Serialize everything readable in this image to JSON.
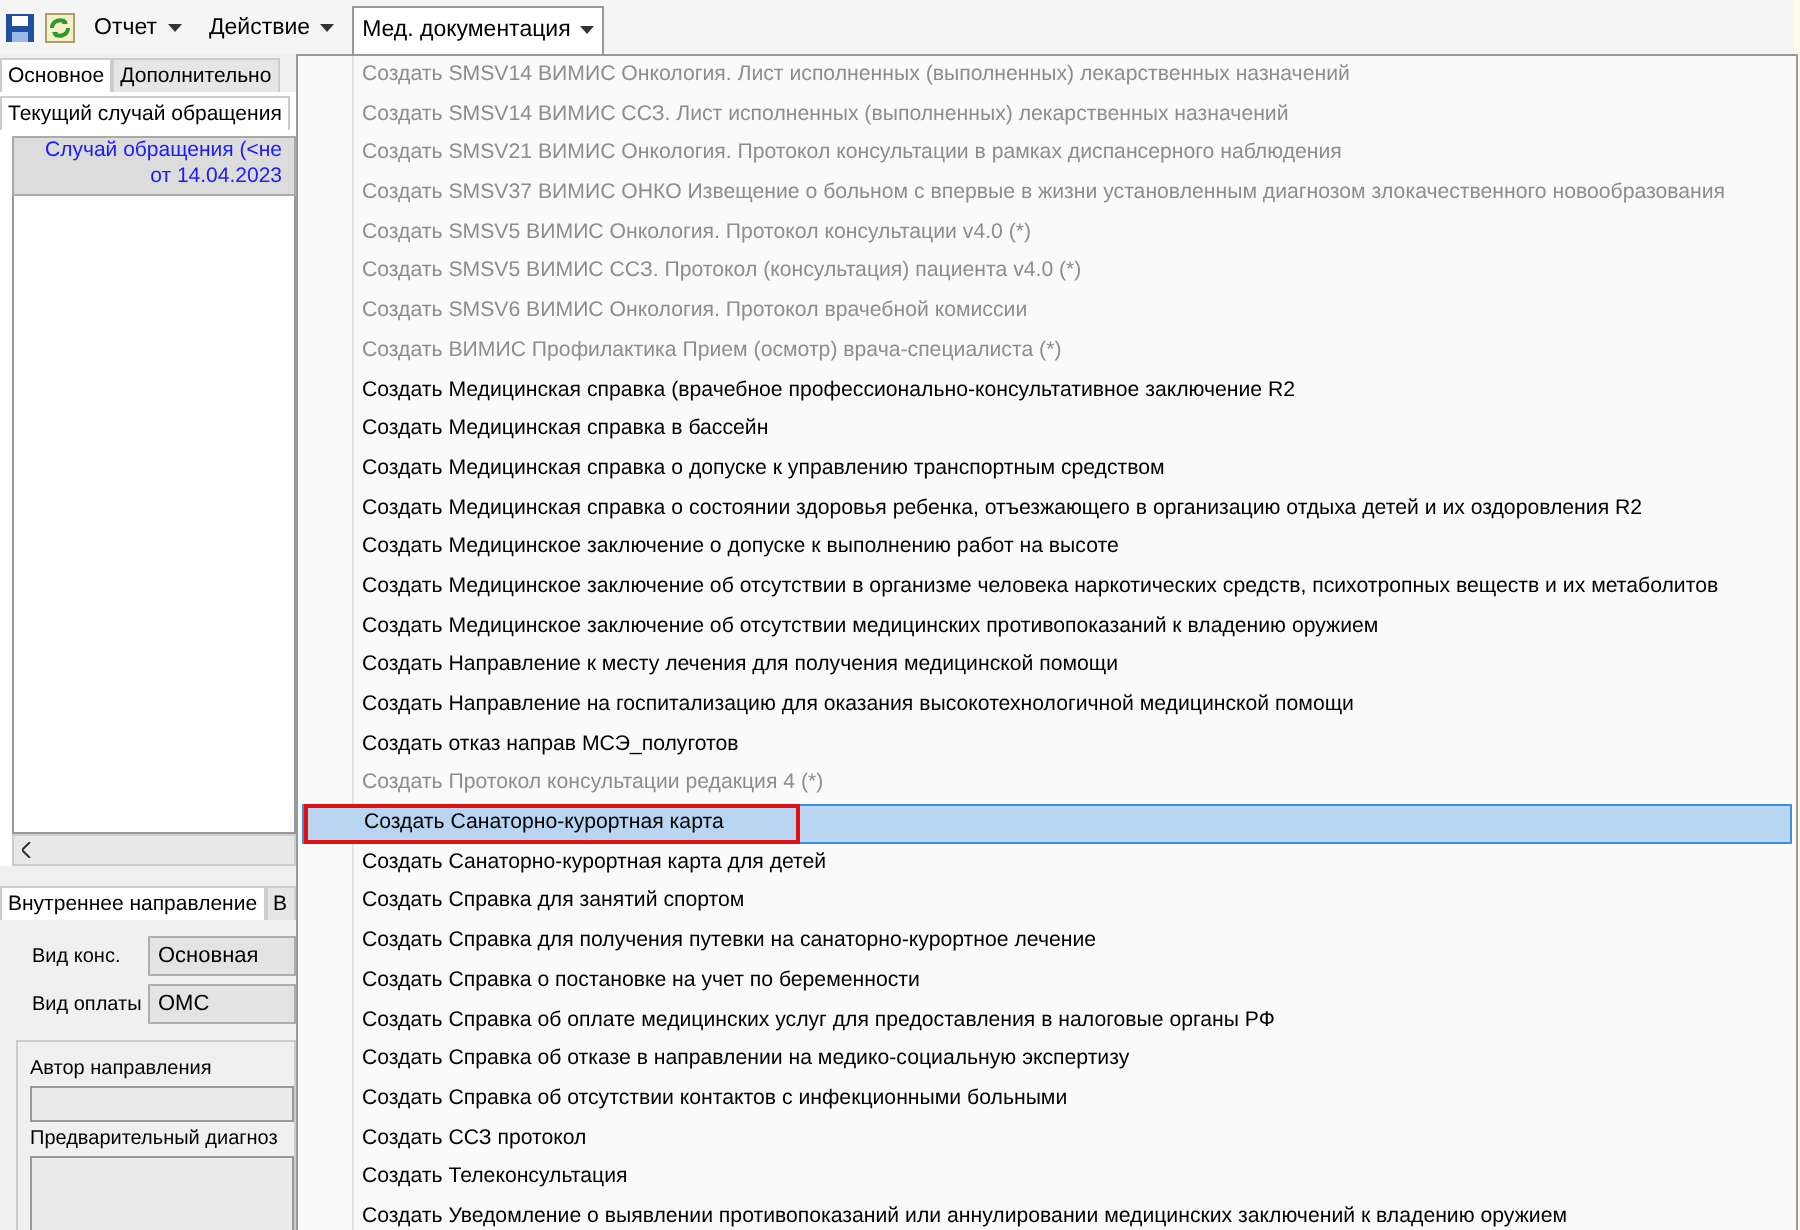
{
  "toolbar": {
    "menus": [
      {
        "label": "Отчет",
        "open": false
      },
      {
        "label": "Действие",
        "open": false
      },
      {
        "label": "Мед. документация",
        "open": true
      }
    ]
  },
  "left_panel": {
    "tabs": [
      {
        "label": "Основное",
        "selected": true
      },
      {
        "label": "Дополнительно",
        "selected": false
      }
    ],
    "subtabs": [
      {
        "label": "Текущий случай обращения",
        "selected": true
      }
    ],
    "case_header": [
      "Случай обращения (<не",
      "от 14.04.2023"
    ],
    "bottom_tabs": [
      {
        "label": "Внутреннее направление",
        "selected": true
      },
      {
        "label": "В",
        "selected": false
      }
    ],
    "fields": [
      {
        "label": "Вид конс.",
        "value": "Основная"
      },
      {
        "label": "Вид оплаты",
        "value": "ОМС"
      }
    ],
    "author_label": "Автор направления",
    "diagnosis_label": "Предварительный диагноз"
  },
  "menu": {
    "items": [
      {
        "label": "Создать SMSV14 ВИМИС  Онкология. Лист исполненных (выполненных) лекарственных назначений",
        "disabled": true,
        "selected": false
      },
      {
        "label": "Создать SMSV14 ВИМИС ССЗ. Лист исполненных (выполненных) лекарственных назначений",
        "disabled": true,
        "selected": false
      },
      {
        "label": "Создать SMSV21 ВИМИС Онкология. Протокол консультации в рамках диспансерного наблюдения",
        "disabled": true,
        "selected": false
      },
      {
        "label": "Создать SMSV37 ВИМИС ОНКО Извещение о больном с впервые в жизни установленным диагнозом злокачественного новообразования",
        "disabled": true,
        "selected": false
      },
      {
        "label": "Создать SMSV5 ВИМИС Онкология. Протокол консультации v4.0 (*)",
        "disabled": true,
        "selected": false
      },
      {
        "label": "Создать SMSV5 ВИМИС ССЗ. Протокол (консультация) пациента v4.0 (*)",
        "disabled": true,
        "selected": false
      },
      {
        "label": "Создать SMSV6 ВИМИС Онкология. Протокол врачебной комиссии",
        "disabled": true,
        "selected": false
      },
      {
        "label": "Создать ВИМИС Профилактика Прием (осмотр) врача-специалиста (*)",
        "disabled": true,
        "selected": false
      },
      {
        "label": "Создать Медицинская справка (врачебное профессионально-консультативное заключение R2",
        "disabled": false,
        "selected": false
      },
      {
        "label": "Создать Медицинская справка в бассейн",
        "disabled": false,
        "selected": false
      },
      {
        "label": "Создать Медицинская справка о допуске к управлению транспортным средством",
        "disabled": false,
        "selected": false
      },
      {
        "label": "Создать Медицинская справка о состоянии здоровья ребенка, отъезжающего в организацию отдыха детей и их оздоровления R2",
        "disabled": false,
        "selected": false
      },
      {
        "label": "Создать Медицинское заключение о допуске к выполнению работ на высоте",
        "disabled": false,
        "selected": false
      },
      {
        "label": "Создать Медицинское заключение об отсутствии в организме человека наркотических средств, психотропных веществ и их метаболитов",
        "disabled": false,
        "selected": false
      },
      {
        "label": "Создать Медицинское заключение об отсутствии медицинских противопоказаний к владению оружием",
        "disabled": false,
        "selected": false
      },
      {
        "label": "Создать Направление к месту лечения для получения медицинской помощи",
        "disabled": false,
        "selected": false
      },
      {
        "label": "Создать Направление на госпитализацию для оказания высокотехнологичной медицинской помощи",
        "disabled": false,
        "selected": false
      },
      {
        "label": "Создать отказ направ МСЭ_полуготов",
        "disabled": false,
        "selected": false
      },
      {
        "label": "Создать Протокол консультации редакция 4 (*)",
        "disabled": true,
        "selected": false
      },
      {
        "label": "Создать Санаторно-курортная карта",
        "disabled": false,
        "selected": true
      },
      {
        "label": "Создать Санаторно-курортная карта для детей",
        "disabled": false,
        "selected": false
      },
      {
        "label": "Создать Справка для занятий спортом",
        "disabled": false,
        "selected": false
      },
      {
        "label": "Создать Справка для получения путевки на санаторно-курортное лечение",
        "disabled": false,
        "selected": false
      },
      {
        "label": "Создать Справка о постановке на учет по беременности",
        "disabled": false,
        "selected": false
      },
      {
        "label": "Создать Справка об оплате медицинских услуг для предоставления в налоговые органы РФ",
        "disabled": false,
        "selected": false
      },
      {
        "label": "Создать Справка об отказе в направлении на медико-социальную экспертизу",
        "disabled": false,
        "selected": false
      },
      {
        "label": "Создать Справка об отсутствии контактов с инфекционными больными",
        "disabled": false,
        "selected": false
      },
      {
        "label": "Создать ССЗ протокол",
        "disabled": false,
        "selected": false
      },
      {
        "label": "Создать Телеконсультация",
        "disabled": false,
        "selected": false
      },
      {
        "label": "Создать Уведомление о выявлении противопоказаний или аннулировании медицинских заключений к владению оружием",
        "disabled": false,
        "selected": false
      }
    ]
  }
}
